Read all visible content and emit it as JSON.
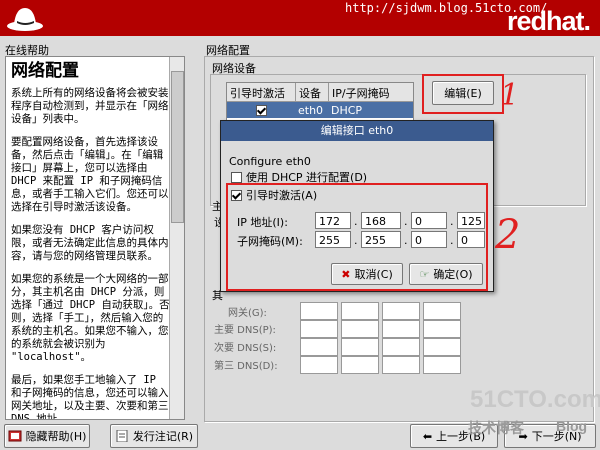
{
  "banner": {
    "url": "http://sjdwm.blog.51cto.com/",
    "brand": "redhat."
  },
  "help": {
    "section_label": "在线帮助",
    "heading": "网络配置",
    "paragraphs": [
      "系统上所有的网络设备将会被安装程序自动检测到，并显示在「网络设备」列表中。",
      "要配置网络设备，首先选择该设备，然后点击「编辑」。在「编辑接口」屏幕上，您可以选择由 DHCP 来配置 IP 和子网掩码信息，或者手工输入它们。您还可以选择在引导时激活该设备。",
      "如果您没有 DHCP 客户访问权限，或者无法确定此信息的具体内容，请与您的网络管理员联系。",
      "如果您的系统是一个大网络的一部分，其主机名由 DHCP 分派，则选择「通过 DHCP 自动获取」。否则，选择「手工」，然后输入您的系统的主机名。如果您不输入，您的系统就会被识别为 \"localhost\"。",
      "最后，如果您手工地输入了 IP 和子网掩码的信息，您还可以输入网关地址，以及主要、次要和第三 DNS 地址。"
    ]
  },
  "footer": {
    "hide_help": "隐藏帮助(H)",
    "release_notes": "发行注记(R)",
    "back": "上一步(B)",
    "next": "下一步(N)"
  },
  "netconfig": {
    "title": "网络配置",
    "devices_label": "网络设备",
    "columns": [
      "引导时激活",
      "设备",
      "IP/子网掩码"
    ],
    "rows": [
      {
        "boot": true,
        "device": "eth0",
        "ip": "DHCP"
      }
    ],
    "edit_button": "编辑(E)",
    "host_label": "主",
    "host_label2": "设",
    "misc_label": "其",
    "gateway_label": "网关(G):",
    "dns1_label": "主要 DNS(P):",
    "dns2_label": "次要 DNS(S):",
    "dns3_label": "第三 DNS(D):"
  },
  "dialog": {
    "title": "编辑接口 eth0",
    "configure_label": "Configure eth0",
    "dhcp_label": "使用 DHCP 进行配置(D)",
    "dhcp_checked": false,
    "boot_label": "引导时激活(A)",
    "boot_checked": true,
    "ip_label": "IP 地址(I):",
    "mask_label": "子网掩码(M):",
    "ip": [
      "172",
      "168",
      "0",
      "125"
    ],
    "mask": [
      "255",
      "255",
      "0",
      "0"
    ],
    "cancel": "取消(C)",
    "ok": "确定(O)"
  },
  "annotations": {
    "one": "1",
    "two": "2",
    "color": "#e02020"
  },
  "watermark": {
    "line1": "51CTO.com",
    "line2": "技术博客",
    "line3": "Blog"
  }
}
